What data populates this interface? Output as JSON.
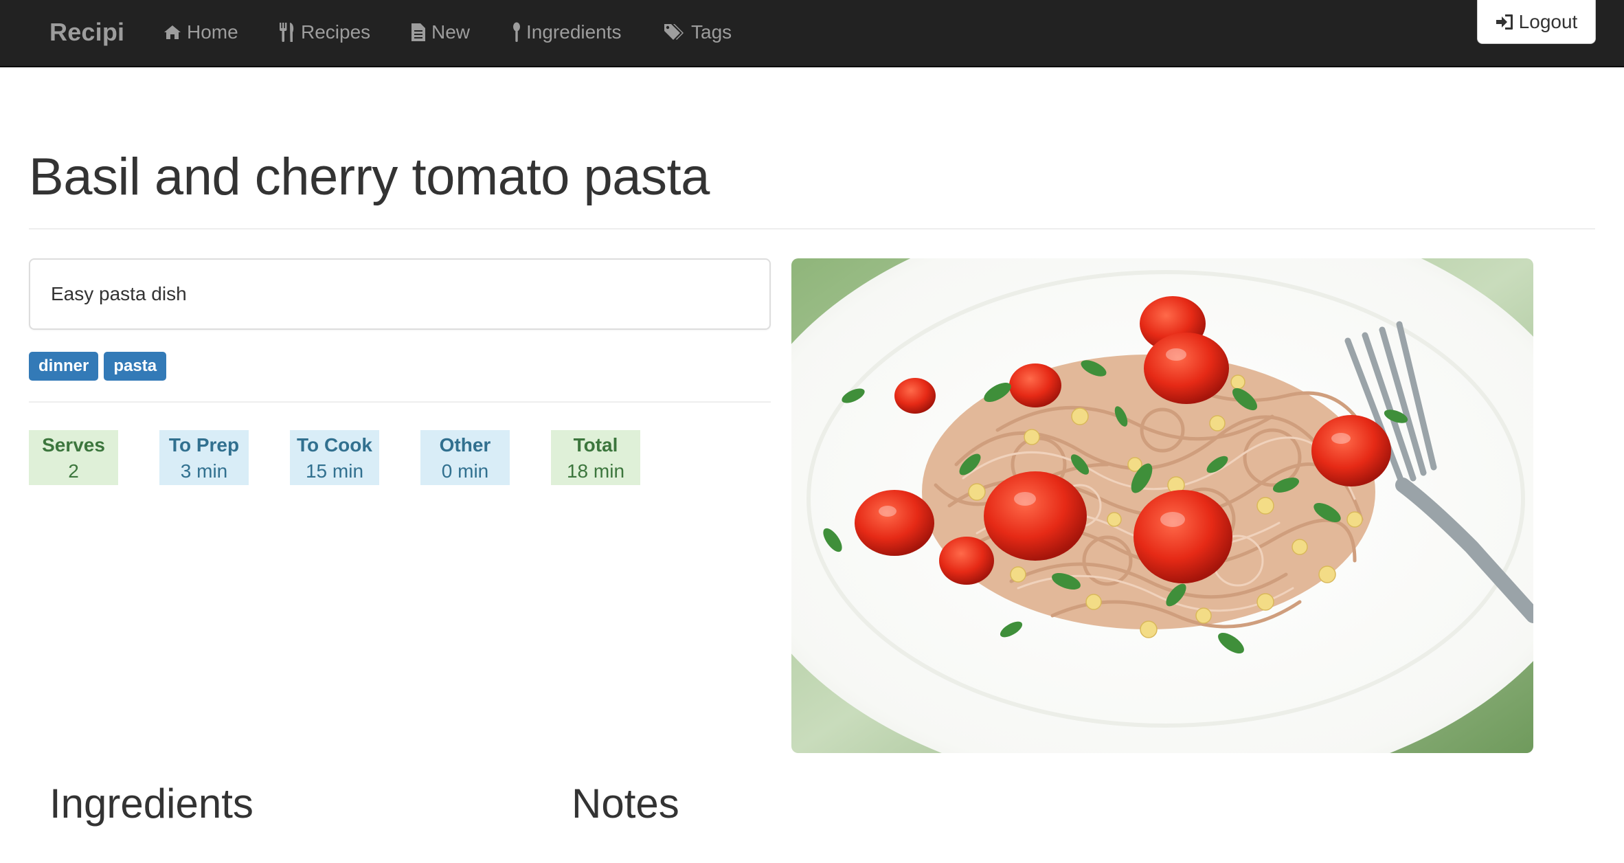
{
  "navbar": {
    "brand": "Recipi",
    "items": [
      {
        "label": "Home",
        "icon": "home-icon"
      },
      {
        "label": "Recipes",
        "icon": "cutlery-icon"
      },
      {
        "label": "New",
        "icon": "file-icon"
      },
      {
        "label": "Ingredients",
        "icon": "ingredient-icon"
      },
      {
        "label": "Tags",
        "icon": "tags-icon"
      }
    ],
    "logout": {
      "label": "Logout",
      "icon": "log-in-icon"
    },
    "background": "#222222",
    "text_color": "#9d9d9d"
  },
  "recipe": {
    "title": "Basil and cherry tomato pasta",
    "description": "Easy pasta dish",
    "tags": [
      "dinner",
      "pasta"
    ],
    "tag_color": "#337ab7",
    "stats": {
      "serves": {
        "label": "Serves",
        "value": "2"
      },
      "prep": {
        "label": "To Prep",
        "value": "3 min"
      },
      "cook": {
        "label": "To Cook",
        "value": "15 min"
      },
      "other": {
        "label": "Other",
        "value": "0 min"
      },
      "total": {
        "label": "Total",
        "value": "18 min"
      }
    },
    "stat_colors": {
      "green_bg": "#dff0d8",
      "green_text": "#3c763d",
      "blue_bg": "#d9edf7",
      "blue_text": "#31708f"
    },
    "photo": "pasta-dish-photo"
  },
  "sections": {
    "ingredients": "Ingredients",
    "notes": "Notes"
  }
}
